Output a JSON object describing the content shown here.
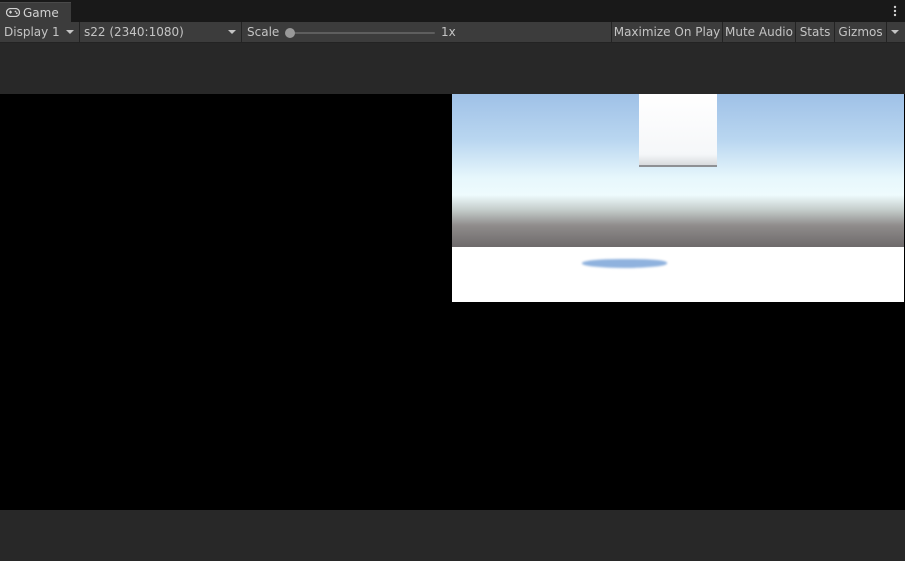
{
  "tab": {
    "title": "Game",
    "icon": "gamepad-icon"
  },
  "toolbar": {
    "display_label": "Display 1",
    "resolution_label": "s22 (2340:1080)",
    "scale_label": "Scale",
    "scale_value": "1x",
    "scale_level": 0,
    "maximize_label": "Maximize On Play",
    "mute_label": "Mute Audio",
    "stats_label": "Stats",
    "gizmos_label": "Gizmos"
  },
  "colors": {
    "panel_bg": "#282828",
    "toolbar_bg": "#3c3c3c",
    "tabstrip_bg": "#191919",
    "sky_top": "#9fc1e7",
    "horizon": "#eefbfd",
    "ground_band": "#6e6a6b",
    "floor": "#ffffff",
    "shadow": "#8fb2de"
  }
}
